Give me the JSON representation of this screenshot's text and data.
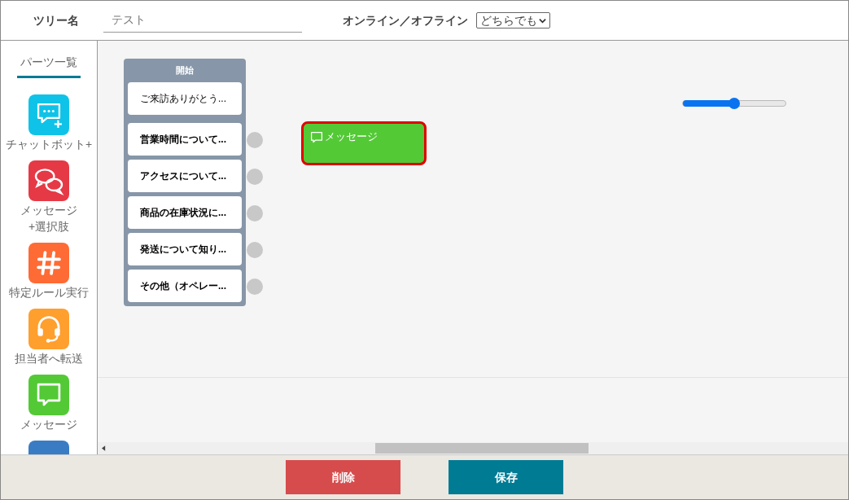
{
  "header": {
    "tree_name_label": "ツリー名",
    "tree_name_value": "テスト",
    "online_label": "オンライン／オフライン",
    "online_select": "どちらでも"
  },
  "sidebar": {
    "title": "パーツ一覧",
    "parts": [
      {
        "kind": "chatbot",
        "label": "チャットボット+",
        "color": "#0fc3e8"
      },
      {
        "kind": "message-choice",
        "label": "メッセージ\n+選択肢",
        "color": "#e63946"
      },
      {
        "kind": "rule",
        "label": "特定ルール実行",
        "color": "#ff6b35"
      },
      {
        "kind": "transfer",
        "label": "担当者へ転送",
        "color": "#ff9f2e"
      },
      {
        "kind": "message",
        "label": "メッセージ",
        "color": "#53c936"
      },
      {
        "kind": "flow",
        "color": "#3a7cc4"
      }
    ]
  },
  "canvas": {
    "start_node": {
      "title": "開始",
      "items": [
        {
          "kind": "message",
          "label": "ご来訪ありがとう..."
        },
        {
          "kind": "choice",
          "label": "営業時間について..."
        },
        {
          "kind": "choice",
          "label": "アクセスについて..."
        },
        {
          "kind": "choice",
          "label": "商品の在庫状況に..."
        },
        {
          "kind": "choice",
          "label": "発送について知り..."
        },
        {
          "kind": "choice",
          "label": "その他（オペレー..."
        }
      ]
    },
    "nodes": [
      {
        "label": "メッセージ",
        "selected": true
      }
    ],
    "zoom_slider": {
      "level": 0.5
    }
  },
  "buttons": [
    {
      "kind": "delete",
      "label": "削除"
    },
    {
      "kind": "save",
      "label": "保存"
    }
  ]
}
